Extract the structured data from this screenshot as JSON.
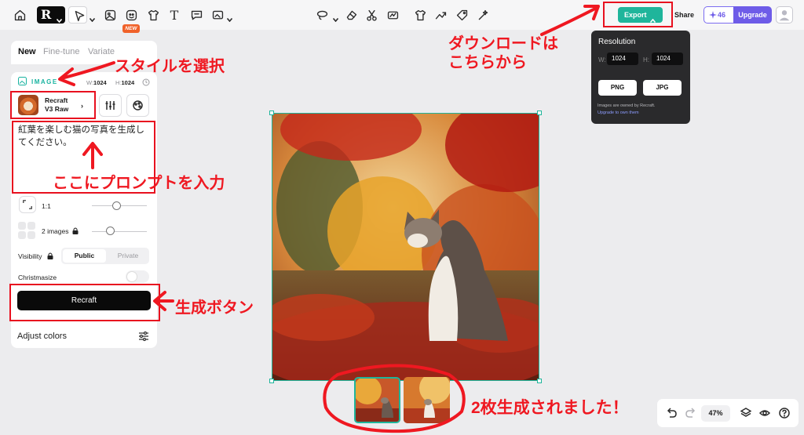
{
  "toolbar": {
    "new_badge": "NEW",
    "text_tool_glyph": "T",
    "logo_glyph": "R",
    "export_label": "Export",
    "share_label": "Share",
    "credits": "46",
    "upgrade_label": "Upgrade"
  },
  "export_popover": {
    "title": "Resolution",
    "w_label": "W:",
    "w_value": "1024",
    "h_label": "H:",
    "h_value": "1024",
    "png_label": "PNG",
    "jpg_label": "JPG",
    "note": "Images are owned by Recraft.",
    "note_link": "Upgrade to own them"
  },
  "panel": {
    "tabs": [
      "New",
      "Fine-tune",
      "Variate"
    ],
    "image_label": "IMAGE",
    "w_label": "W:",
    "w_value": "1024",
    "h_label": "H:",
    "h_value": "1024",
    "model_line1": "Recraft",
    "model_line2": "V3 Raw",
    "prompt": "紅葉を楽しむ猫の写真を生成してください。",
    "ratio": "1:1",
    "images_count": "2 images",
    "visibility_label": "Visibility",
    "visibility_public": "Public",
    "visibility_private": "Private",
    "christmasize_label": "Christmasize",
    "recraft_button": "Recraft",
    "adjust_colors": "Adjust colors"
  },
  "bottom": {
    "zoom": "47%"
  },
  "annotations": {
    "download_line1": "ダウンロードは",
    "download_line2": "こちらから",
    "style": "スタイルを選択",
    "prompt": "ここにプロンプトを入力",
    "generate": "生成ボタン",
    "done": "2枚生成されました！"
  },
  "colors": {
    "accent": "#1fb59b",
    "upgrade": "#6e5ce8",
    "annotation": "#ef1821",
    "new_badge": "#f0622a"
  },
  "icons": [
    "home-icon",
    "logo-icon",
    "select-arrow-icon",
    "image-icon",
    "sticker-icon",
    "shirt-icon",
    "text-icon",
    "comment-icon",
    "frame-icon",
    "lasso-icon",
    "eraser-icon",
    "scissors-icon",
    "vectorize-icon",
    "shirt-icon",
    "upscale-icon",
    "tag-icon",
    "wand-icon",
    "sparkle-icon",
    "user-icon",
    "undo-icon",
    "redo-icon",
    "layers-icon",
    "eye-icon",
    "help-icon"
  ]
}
